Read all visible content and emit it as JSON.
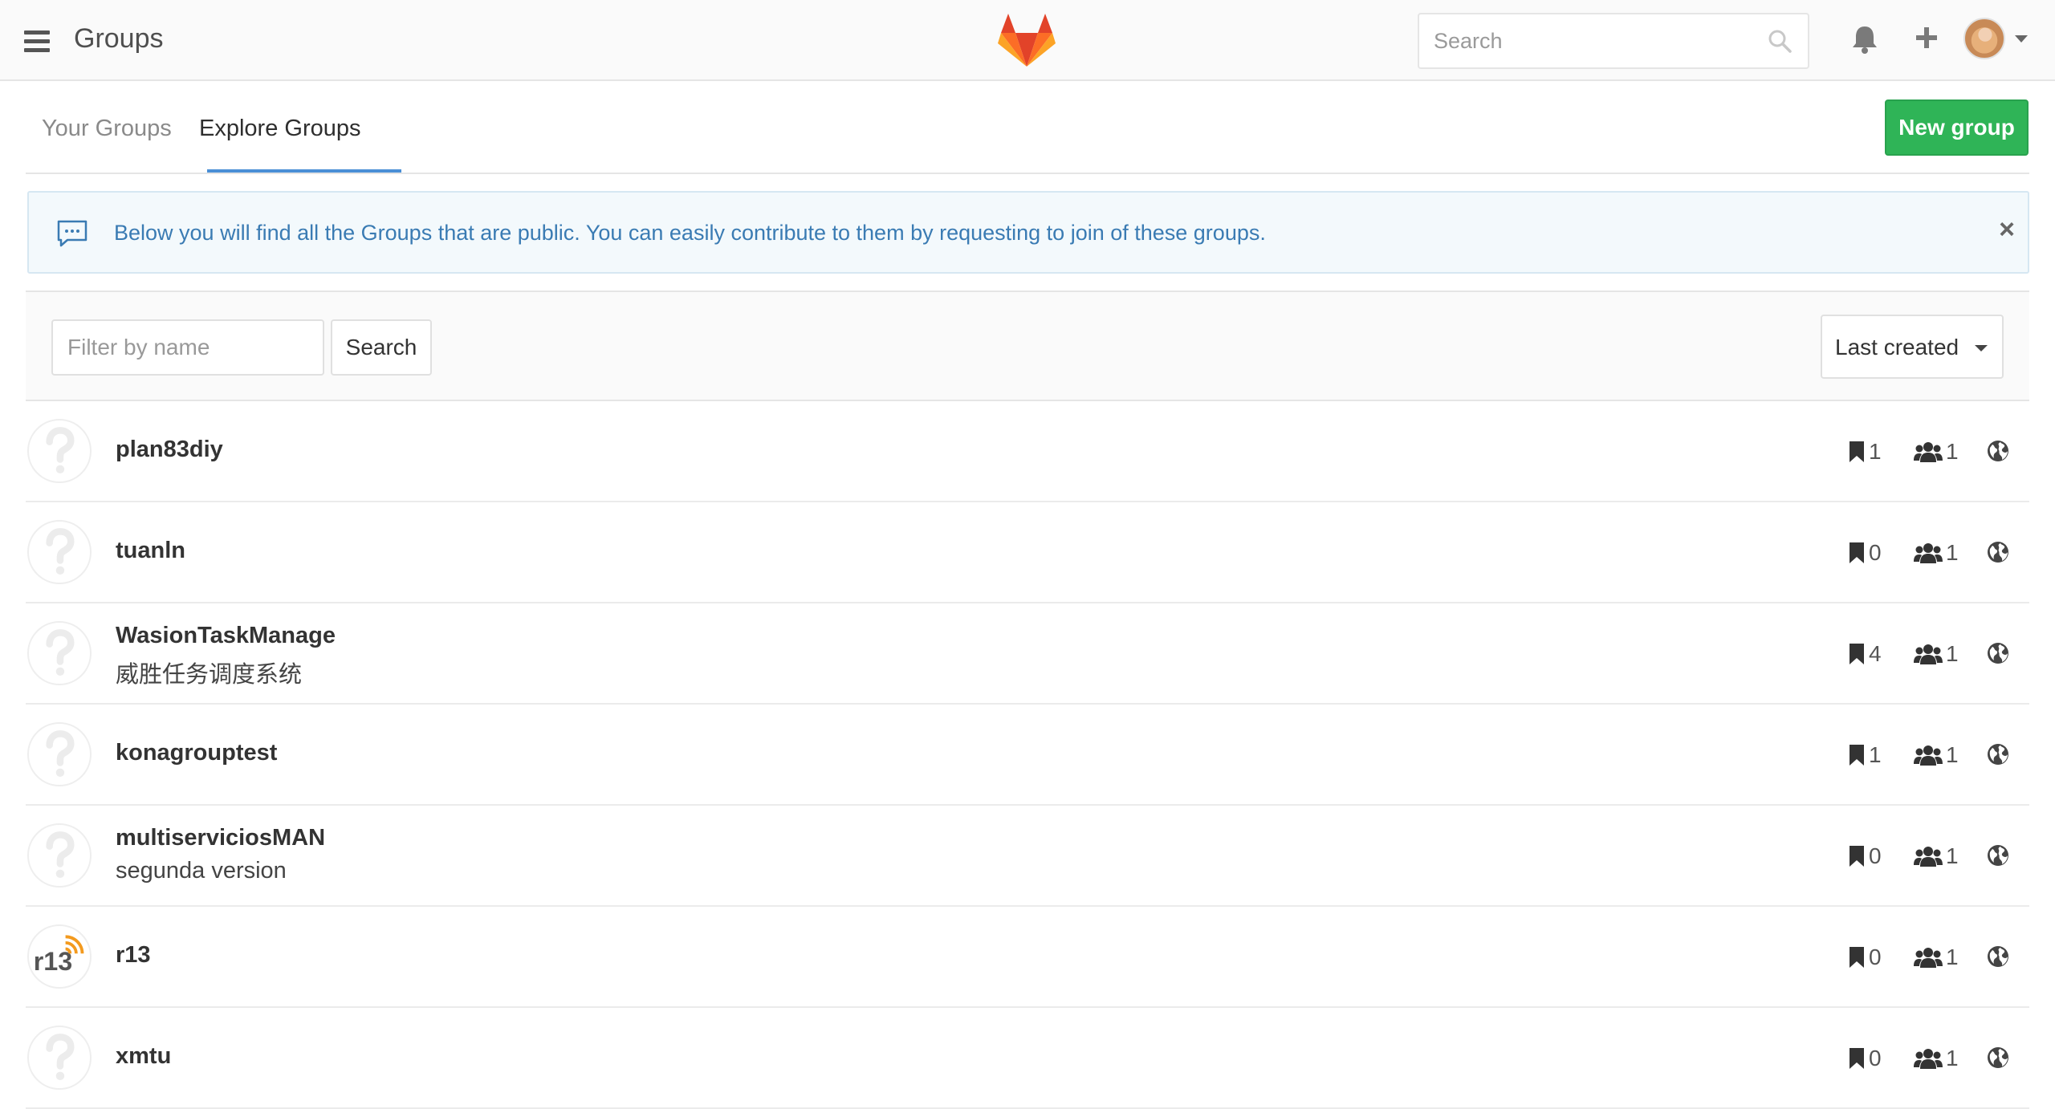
{
  "header": {
    "title": "Groups",
    "search_placeholder": "Search"
  },
  "tabs": [
    {
      "label": "Your Groups",
      "active": false
    },
    {
      "label": "Explore Groups",
      "active": true
    }
  ],
  "new_group_label": "New group",
  "banner": {
    "text": "Below you will find all the Groups that are public. You can easily contribute to them by requesting to join of these groups."
  },
  "filter": {
    "placeholder": "Filter by name",
    "search_label": "Search",
    "sort_label": "Last created"
  },
  "groups": [
    {
      "name": "plan83diy",
      "description": "",
      "projects": "1",
      "members": "1",
      "avatar": "question-icon"
    },
    {
      "name": "tuanln",
      "description": "",
      "projects": "0",
      "members": "1",
      "avatar": "question-icon"
    },
    {
      "name": "WasionTaskManage",
      "description": "威胜任务调度系统",
      "projects": "4",
      "members": "1",
      "avatar": "question-icon"
    },
    {
      "name": "konagrouptest",
      "description": "",
      "projects": "1",
      "members": "1",
      "avatar": "question-icon"
    },
    {
      "name": "multiserviciosMAN",
      "description": "segunda version",
      "projects": "0",
      "members": "1",
      "avatar": "question-icon"
    },
    {
      "name": "r13",
      "description": "",
      "projects": "0",
      "members": "1",
      "avatar": "r13-logo"
    },
    {
      "name": "xmtu",
      "description": "",
      "projects": "0",
      "members": "1",
      "avatar": "question-icon"
    }
  ],
  "colors": {
    "primary_button": "#2fb457",
    "tab_active_underline": "#4a8fd6",
    "banner_text": "#3a7bb3",
    "banner_bg": "#f3f9fc"
  }
}
